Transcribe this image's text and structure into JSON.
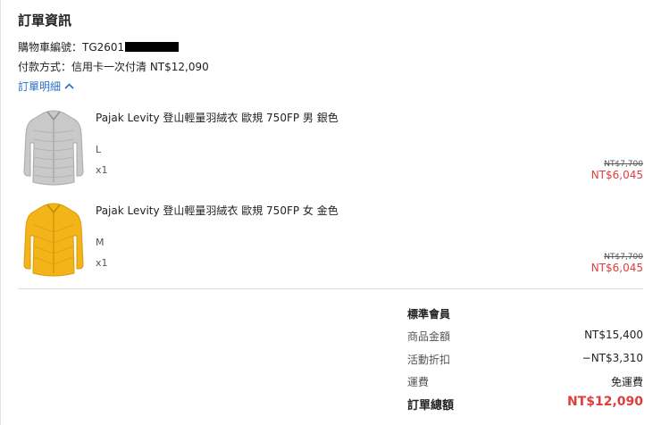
{
  "order": {
    "title": "訂單資訊",
    "cart_label": "購物車編號：",
    "cart_number": "TG2601",
    "payment_label": "付款方式：",
    "payment_method": "信用卡一次付清 NT$12,090",
    "details_toggle": "訂單明細"
  },
  "items": [
    {
      "name": "Pajak Levity 登山輕量羽絨衣 歐規 750FP 男 銀色",
      "variant": "L",
      "qty": "x1",
      "original_price": "NT$7,700",
      "sale_price": "NT$6,045",
      "color": "#c9c9c9"
    },
    {
      "name": "Pajak Levity 登山輕量羽絨衣 歐規 750FP 女 金色",
      "variant": "M",
      "qty": "x1",
      "original_price": "NT$7,700",
      "sale_price": "NT$6,045",
      "color": "#f2b418"
    }
  ],
  "summary": {
    "title": "標準會員",
    "subtotal_label": "商品金額",
    "subtotal_value": "NT$15,400",
    "discount_label": "活動折扣",
    "discount_value": "−NT$3,310",
    "shipping_label": "運費",
    "shipping_value": "免運費",
    "total_label": "訂單總額",
    "total_value": "NT$12,090"
  },
  "colors": {
    "link": "#2a6fc9",
    "sale": "#e03d3d"
  }
}
